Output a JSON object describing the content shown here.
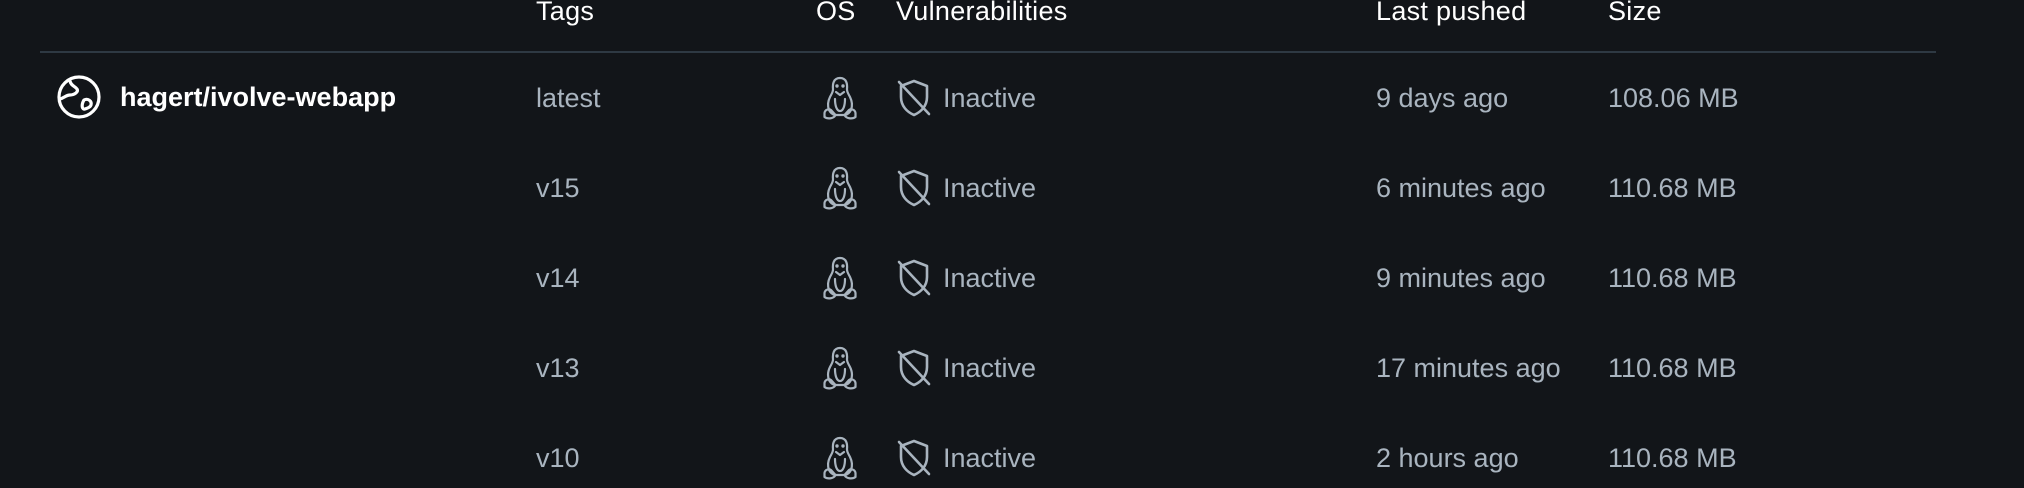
{
  "columns": {
    "tags": "Tags",
    "os": "OS",
    "vulnerabilities": "Vulnerabilities",
    "last_pushed": "Last pushed",
    "size": "Size"
  },
  "repository": {
    "name": "hagert/ivolve-webapp",
    "icon": "public-globe-icon"
  },
  "rows": [
    {
      "tag": "latest",
      "os_icon": "linux-icon",
      "vuln_icon": "shield-off-icon",
      "vulnerability": "Inactive",
      "last_pushed": "9 days ago",
      "size": "108.06 MB"
    },
    {
      "tag": "v15",
      "os_icon": "linux-icon",
      "vuln_icon": "shield-off-icon",
      "vulnerability": "Inactive",
      "last_pushed": "6 minutes ago",
      "size": "110.68 MB"
    },
    {
      "tag": "v14",
      "os_icon": "linux-icon",
      "vuln_icon": "shield-off-icon",
      "vulnerability": "Inactive",
      "last_pushed": "9 minutes ago",
      "size": "110.68 MB"
    },
    {
      "tag": "v13",
      "os_icon": "linux-icon",
      "vuln_icon": "shield-off-icon",
      "vulnerability": "Inactive",
      "last_pushed": "17 minutes ago",
      "size": "110.68 MB"
    },
    {
      "tag": "v10",
      "os_icon": "linux-icon",
      "vuln_icon": "shield-off-icon",
      "vulnerability": "Inactive",
      "last_pushed": "2 hours ago",
      "size": "110.68 MB"
    }
  ],
  "colors": {
    "background": "#121519",
    "text_primary": "#ffffff",
    "text_secondary": "#a9b4bf",
    "divider": "#2e3943"
  }
}
